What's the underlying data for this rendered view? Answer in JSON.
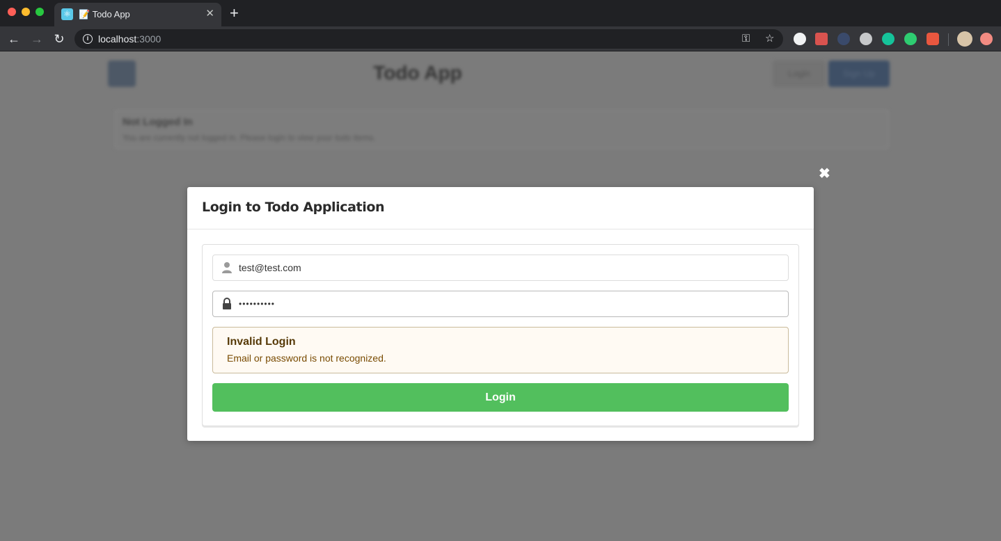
{
  "browser": {
    "tab_title": "📝 Todo App",
    "tab_close": "✕",
    "new_tab": "+",
    "url_host": "localhost",
    "url_port": ":3000"
  },
  "background_page": {
    "title": "Todo App",
    "login_label": "Login",
    "signup_label": "Sign Up",
    "card_header": "Not Logged In",
    "card_body": "You are currently not logged in. Please login to view your todo items."
  },
  "modal": {
    "title": "Login to Todo Application",
    "close": "✖",
    "email_value": "test@test.com",
    "password_value": "••••••••••",
    "error_title": "Invalid Login",
    "error_message": "Email or password is not recognized.",
    "login_button": "Login"
  },
  "colors": {
    "overlay": "#7b7b7b",
    "login_button": "#52bf5d",
    "error_background": "#fffaf3",
    "error_title": "#573a08"
  }
}
